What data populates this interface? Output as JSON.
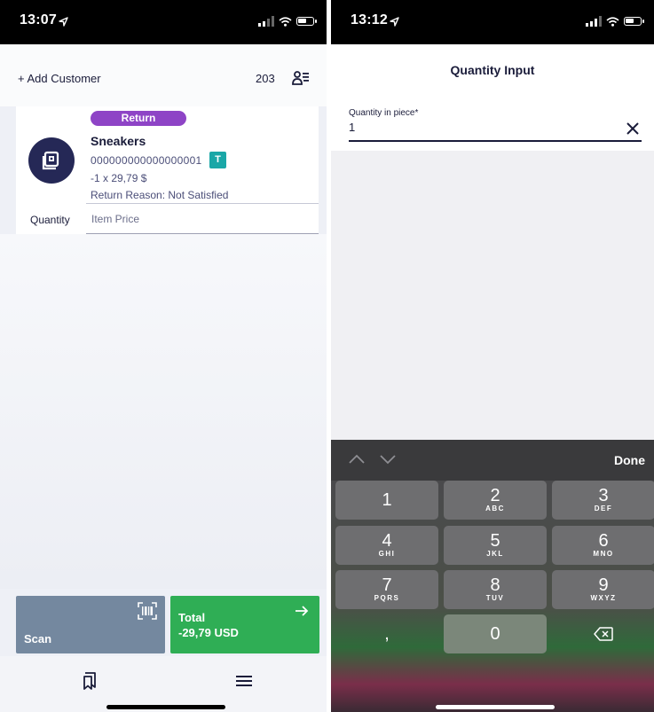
{
  "left": {
    "status_time": "13:07",
    "topbar": {
      "add_customer": "+ Add Customer",
      "customer_count": "203"
    },
    "item": {
      "badge": "Return",
      "name": "Sneakers",
      "barcode": "000000000000000001",
      "tax_badge": "T",
      "price_line": "-1 x 29,79 $",
      "return_reason": "Return Reason:  Not Satisfied",
      "quantity_label": "Quantity",
      "item_price_label": "Item Price"
    },
    "scan_label": "Scan",
    "total": {
      "label": "Total",
      "amount": "-29,79 USD"
    }
  },
  "right": {
    "status_time": "13:12",
    "title": "Quantity Input",
    "field": {
      "label": "Quantity in piece*",
      "value": "1"
    },
    "keyboard": {
      "done_label": "Done",
      "keys": [
        {
          "num": "1",
          "letters": ""
        },
        {
          "num": "2",
          "letters": "ABC"
        },
        {
          "num": "3",
          "letters": "DEF"
        },
        {
          "num": "4",
          "letters": "GHI"
        },
        {
          "num": "5",
          "letters": "JKL"
        },
        {
          "num": "6",
          "letters": "MNO"
        },
        {
          "num": "7",
          "letters": "PQRS"
        },
        {
          "num": "8",
          "letters": "TUV"
        },
        {
          "num": "9",
          "letters": "WXYZ"
        },
        {
          "num": ",",
          "letters": ""
        },
        {
          "num": "0",
          "letters": ""
        }
      ]
    }
  },
  "colors": {
    "return_badge": "#8e44c6",
    "total_button": "#2fae55",
    "scan_button": "#74889f",
    "tax_badge": "#1aa7a7",
    "avatar": "#252856"
  },
  "icons": [
    "location-arrow-icon",
    "signal-icon",
    "wifi-icon",
    "battery-icon",
    "customer-list-icon",
    "product-icon",
    "barcode-scan-icon",
    "arrow-right-icon",
    "receipts-icon",
    "menu-icon",
    "clear-icon",
    "chevron-up-icon",
    "chevron-down-icon",
    "backspace-icon"
  ]
}
